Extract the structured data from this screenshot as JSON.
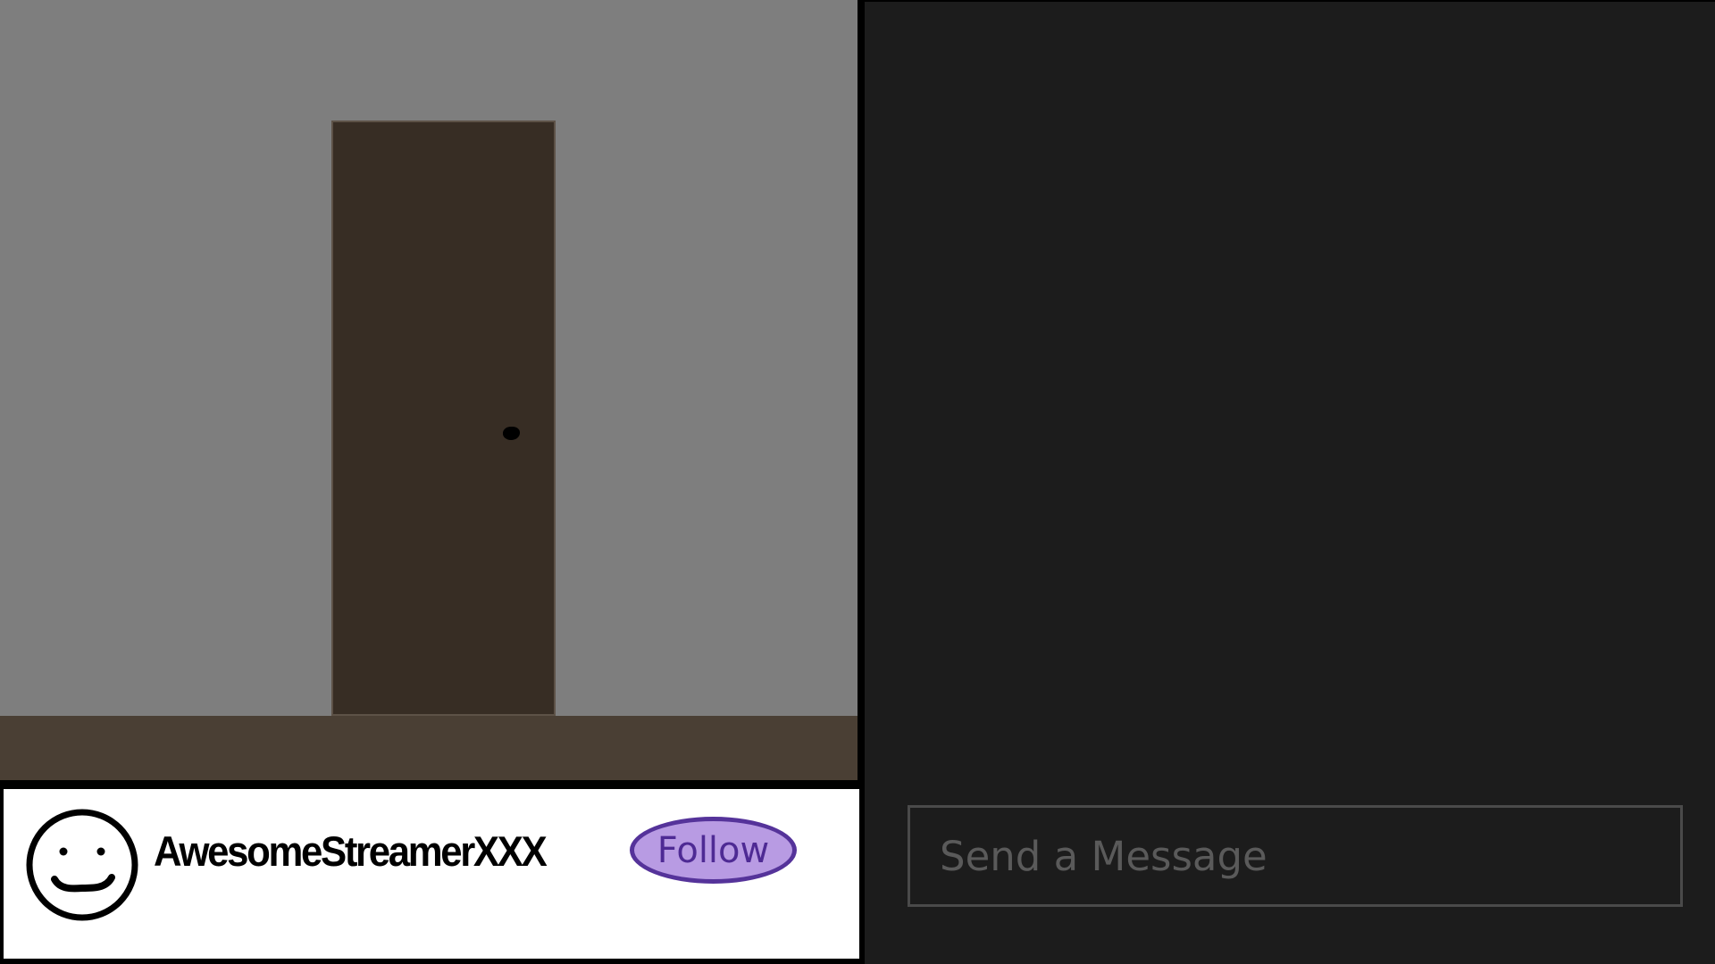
{
  "streamer": {
    "name": "AwesomeStreamerXXX",
    "follow_label": "Follow"
  },
  "chat": {
    "input_placeholder": "Send a Message",
    "input_value": ""
  },
  "icons": {
    "avatar": "smiley-face-icon",
    "door_knob": "door-knob"
  },
  "colors": {
    "wall": "#7e7e7e",
    "floor": "#4a3f34",
    "door": "#372d24",
    "follow_button_fill": "#b89be3",
    "follow_button_border": "#55339a",
    "chat_background": "#1c1c1c",
    "info_bar_background": "#ffffff"
  }
}
